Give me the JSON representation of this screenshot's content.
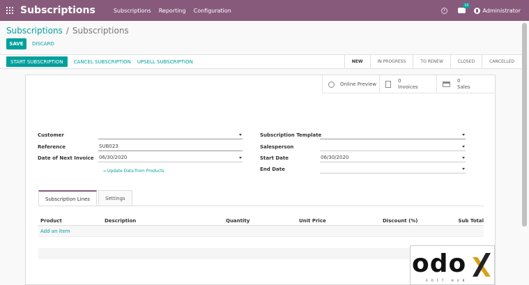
{
  "navbar": {
    "app_title": "Subscriptions",
    "menu": [
      "Subscriptions",
      "Reporting",
      "Configuration"
    ],
    "chat_badge": "10",
    "user_name": "Administrator",
    "color": "#875a7b"
  },
  "breadcrumb": {
    "parent": "Subscriptions",
    "separator": "/",
    "current": "Subscriptions"
  },
  "buttons": {
    "save": "SAVE",
    "discard": "DISCARD"
  },
  "statusbar": {
    "actions": [
      "START SUBSCRIPTION",
      "CANCEL SUBSCRIPTION",
      "UPSELL SUBSCRIPTION"
    ],
    "stages": [
      "NEW",
      "IN PROGRESS",
      "TO RENEW",
      "CLOSED",
      "CANCELLED"
    ],
    "active_stage": "NEW"
  },
  "stat_buttons": {
    "online_preview": "Online Preview",
    "invoices_count": "0",
    "invoices_label": "Invoices",
    "sales_count": "0",
    "sales_label": "Sales"
  },
  "form": {
    "customer_label": "Customer",
    "customer_value": "",
    "reference_label": "Reference",
    "reference_value": "SUB023",
    "next_invoice_label": "Date of Next Invoice",
    "next_invoice_value": "06/30/2020",
    "update_link": "→ Update Data from Products",
    "template_label": "Subscription Template",
    "template_value": "",
    "salesperson_label": "Salesperson",
    "salesperson_value": "",
    "start_date_label": "Start Date",
    "start_date_value": "06/30/2020",
    "end_date_label": "End Date",
    "end_date_value": ""
  },
  "tabs": [
    "Subscription Lines",
    "Settings"
  ],
  "lines_table": {
    "columns": [
      "Product",
      "Description",
      "Quantity",
      "Unit Price",
      "Discount (%)",
      "Sub Total"
    ],
    "add_item": "Add an item"
  },
  "watermark": {
    "letters": "odo",
    "sub": "SOFT HUB"
  },
  "accent_color": "#00a09d"
}
